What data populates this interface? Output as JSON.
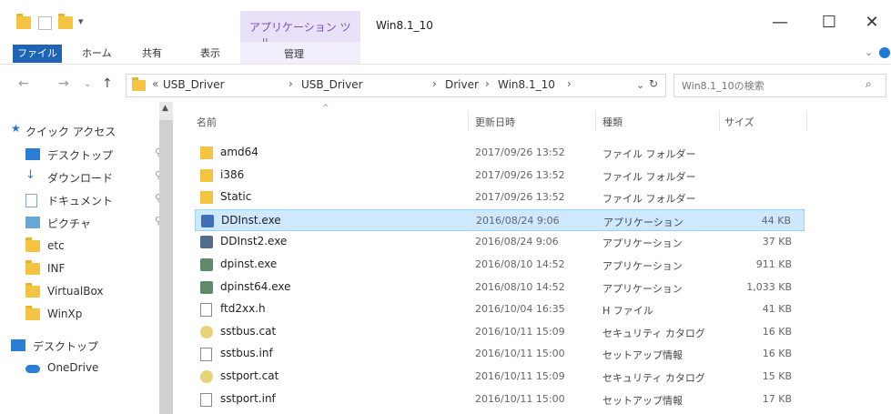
{
  "window": {
    "title": "Win8.1_10",
    "context_tab": "アプリケーション ツール",
    "buttons": {
      "minimize": "—",
      "maximize": "☐",
      "close": "✕"
    }
  },
  "ribbon": {
    "tabs": [
      "ファイル",
      "ホーム",
      "共有",
      "表示"
    ],
    "manage": "管理"
  },
  "address": {
    "path_prefix": "«",
    "crumbs": [
      "USB_Driver",
      "USB_Driver",
      "Driver",
      "Win8.1_10"
    ],
    "search_placeholder": "Win8.1_10の検索"
  },
  "navpane": {
    "items": [
      {
        "label": "クイック アクセス",
        "icon": "star-icon"
      },
      {
        "label": "デスクトップ",
        "icon": "desktop-icon",
        "pinned": true
      },
      {
        "label": "ダウンロード",
        "icon": "download-icon",
        "pinned": true
      },
      {
        "label": "ドキュメント",
        "icon": "document-icon",
        "pinned": true
      },
      {
        "label": "ピクチャ",
        "icon": "picture-icon",
        "pinned": true
      },
      {
        "label": "etc",
        "icon": "folder-icon"
      },
      {
        "label": "INF",
        "icon": "folder-icon"
      },
      {
        "label": "VirtualBox",
        "icon": "folder-icon"
      },
      {
        "label": "WinXp",
        "icon": "folder-icon"
      },
      {
        "label": "デスクトップ",
        "icon": "desktop-icon"
      },
      {
        "label": "OneDrive",
        "icon": "cloud-icon"
      }
    ]
  },
  "filelist": {
    "columns": {
      "name": "名前",
      "date": "更新日時",
      "type": "種類",
      "size": "サイズ"
    },
    "rows": [
      {
        "name": "amd64",
        "date": "2017/09/26 13:52",
        "type": "ファイル フォルダー",
        "size": "",
        "icon": "folder-icon"
      },
      {
        "name": "i386",
        "date": "2017/09/26 13:52",
        "type": "ファイル フォルダー",
        "size": "",
        "icon": "folder-icon"
      },
      {
        "name": "Static",
        "date": "2017/09/26 13:52",
        "type": "ファイル フォルダー",
        "size": "",
        "icon": "folder-icon"
      },
      {
        "name": "DDInst.exe",
        "date": "2016/08/24 9:06",
        "type": "アプリケーション",
        "size": "44 KB",
        "icon": "exe-icon",
        "selected": true
      },
      {
        "name": "DDInst2.exe",
        "date": "2016/08/24 9:06",
        "type": "アプリケーション",
        "size": "37 KB",
        "icon": "exe-icon"
      },
      {
        "name": "dpinst.exe",
        "date": "2016/08/10 14:52",
        "type": "アプリケーション",
        "size": "911 KB",
        "icon": "installer-icon"
      },
      {
        "name": "dpinst64.exe",
        "date": "2016/08/10 14:52",
        "type": "アプリケーション",
        "size": "1,033 KB",
        "icon": "installer-icon"
      },
      {
        "name": "ftd2xx.h",
        "date": "2016/10/04 16:35",
        "type": "H ファイル",
        "size": "41 KB",
        "icon": "file-icon"
      },
      {
        "name": "sstbus.cat",
        "date": "2016/10/11 15:09",
        "type": "セキュリティ カタログ",
        "size": "16 KB",
        "icon": "catalog-icon"
      },
      {
        "name": "sstbus.inf",
        "date": "2016/10/11 15:00",
        "type": "セットアップ情報",
        "size": "16 KB",
        "icon": "inf-icon"
      },
      {
        "name": "sstport.cat",
        "date": "2016/10/11 15:09",
        "type": "セキュリティ カタログ",
        "size": "15 KB",
        "icon": "catalog-icon"
      },
      {
        "name": "sstport.inf",
        "date": "2016/10/11 15:00",
        "type": "セットアップ情報",
        "size": "17 KB",
        "icon": "inf-icon"
      }
    ]
  }
}
